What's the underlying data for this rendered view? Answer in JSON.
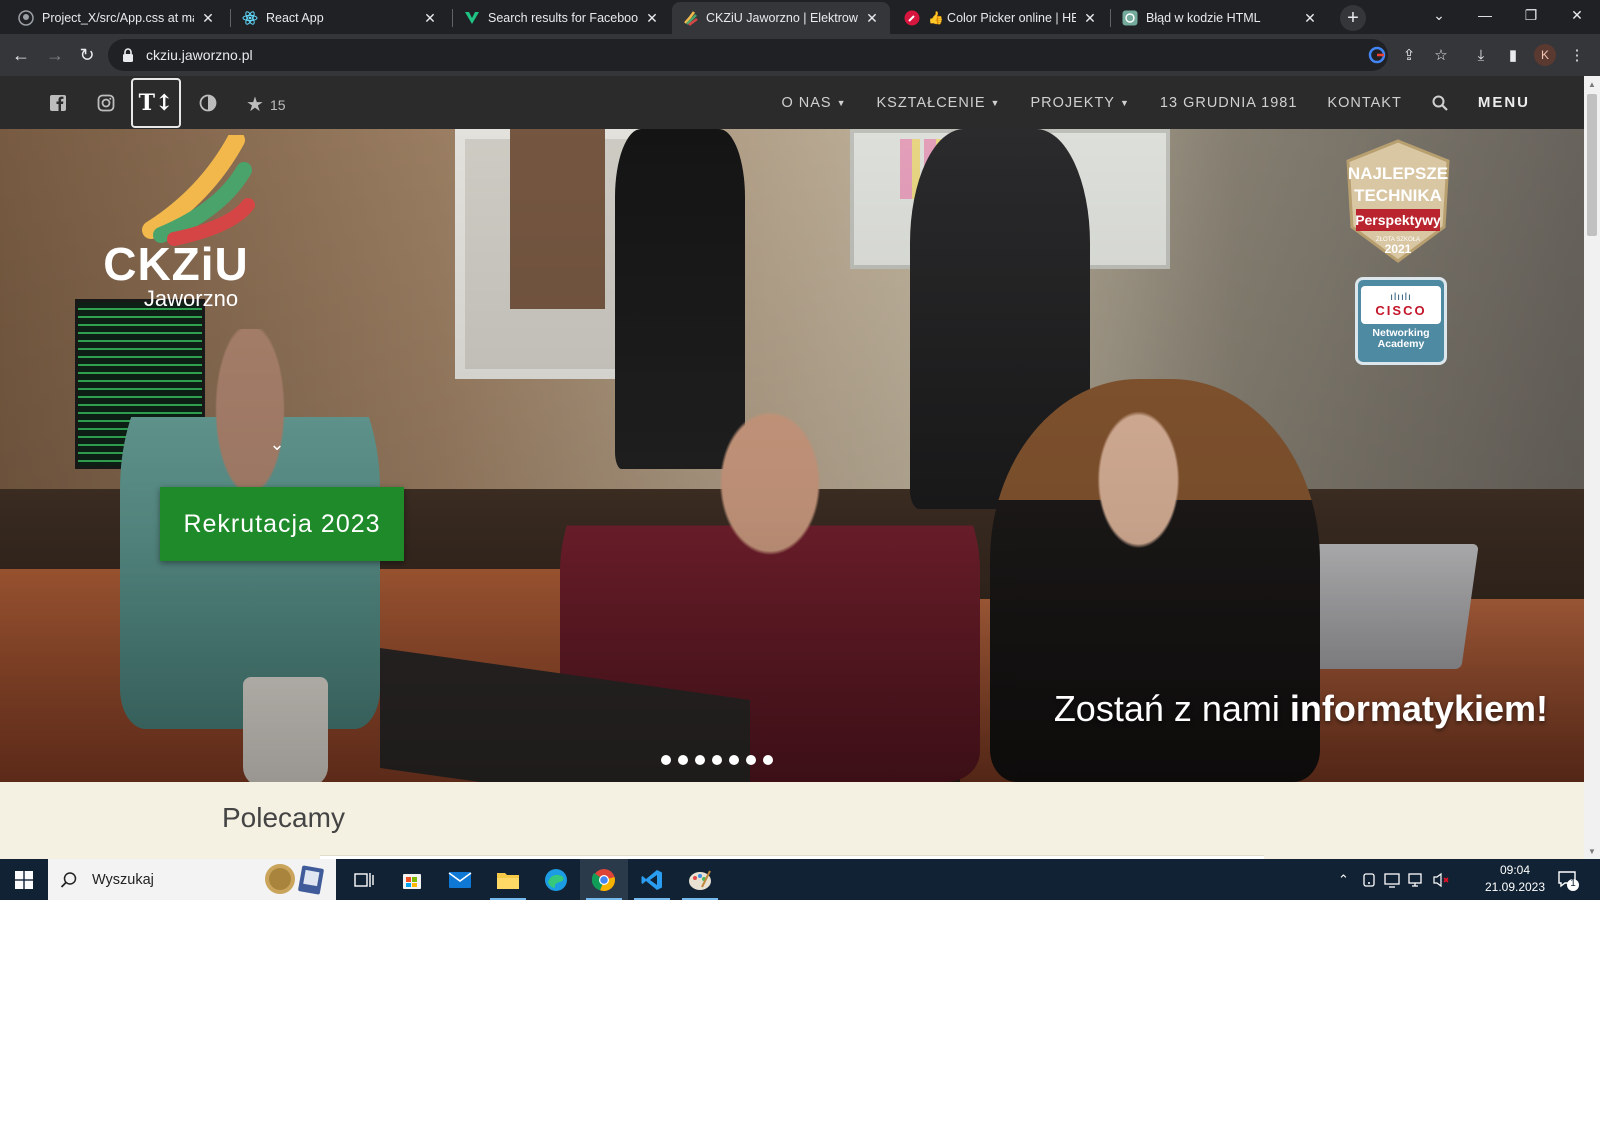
{
  "browser": {
    "tabs": [
      {
        "title": "Project_X/src/App.css at main",
        "icon": "github-icon"
      },
      {
        "title": "React App",
        "icon": "react-icon"
      },
      {
        "title": "Search results for Facebook -",
        "icon": "vuetify-icon"
      },
      {
        "title": "CKZiU Jaworzno | Elektrownia",
        "icon": "ckziu-icon"
      },
      {
        "title": "👍 Color Picker online | HEX C",
        "icon": "color-picker-icon"
      },
      {
        "title": "Błąd w kodzie HTML",
        "icon": "chatgpt-icon"
      }
    ],
    "active_tab_index": 3,
    "url": "ckziu.jaworzno.pl",
    "profile_initial": "K"
  },
  "site": {
    "header": {
      "favorites_count": "15",
      "nav": [
        {
          "label": "O NAS",
          "has_dropdown": true
        },
        {
          "label": "KSZTAŁCENIE",
          "has_dropdown": true
        },
        {
          "label": "PROJEKTY",
          "has_dropdown": true
        },
        {
          "label": "13 GRUDNIA 1981",
          "has_dropdown": false
        },
        {
          "label": "KONTAKT",
          "has_dropdown": false
        }
      ],
      "menu_label": "MENU"
    },
    "hero": {
      "logo_main": "CKZiU",
      "logo_sub": "Jaworzno",
      "cta_label": "Rekrutacja 2023",
      "slogan_regular": "Zostań z nami",
      "slogan_bold": "informatykiem!",
      "slide_count": 7,
      "badge_ranking": {
        "line1": "NAJLEPSZE",
        "line2": "TECHNIKA",
        "line3": "Perspektywy",
        "line4": "ZŁOTA SZKOŁA",
        "year": "2021"
      },
      "badge_cisco": {
        "brand": "CISCO",
        "line1": "Networking",
        "line2": "Academy"
      }
    },
    "section_title": "Polecamy"
  },
  "taskbar": {
    "search_placeholder": "Wyszukaj",
    "time": "09:04",
    "date": "21.09.2023",
    "notifications_count": "1"
  },
  "colors": {
    "site_header_bg": "#2b2b2b",
    "cta_green": "#1e8a2a",
    "section_bg": "#f4f1e2",
    "taskbar_bg": "#102233"
  }
}
